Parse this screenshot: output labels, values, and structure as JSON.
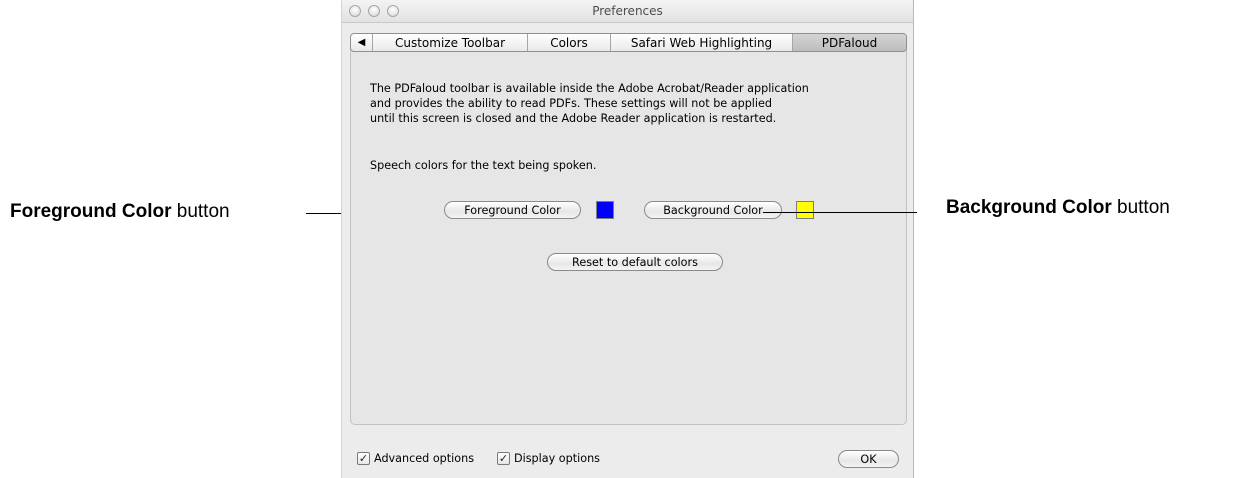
{
  "window": {
    "title": "Preferences"
  },
  "tabs": [
    {
      "label": "◀"
    },
    {
      "label": "Customize Toolbar"
    },
    {
      "label": "Colors"
    },
    {
      "label": "Safari Web Highlighting"
    },
    {
      "label": "PDFaloud"
    }
  ],
  "selected_tab": "PDFaloud",
  "panel": {
    "description_lines": [
      "The PDFaloud toolbar is available inside the Adobe Acrobat/Reader application",
      "and provides the ability to read PDFs. These settings will not be applied",
      "until this screen is closed and the Adobe Reader application is restarted."
    ],
    "speech_label": "Speech colors for the text being spoken.",
    "foreground_button": "Foreground Color",
    "background_button": "Background Color",
    "reset_button": "Reset to default colors",
    "foreground_swatch_color": "#0000ff",
    "background_swatch_color": "#ffff00"
  },
  "footer": {
    "advanced_options": "Advanced options",
    "advanced_checked": true,
    "display_options": "Display options",
    "display_checked": true,
    "ok_button": "OK"
  },
  "callouts": {
    "foreground_bold": "Foreground Color",
    "foreground_rest": " button",
    "background_bold": "Background Color",
    "background_rest": " button"
  }
}
